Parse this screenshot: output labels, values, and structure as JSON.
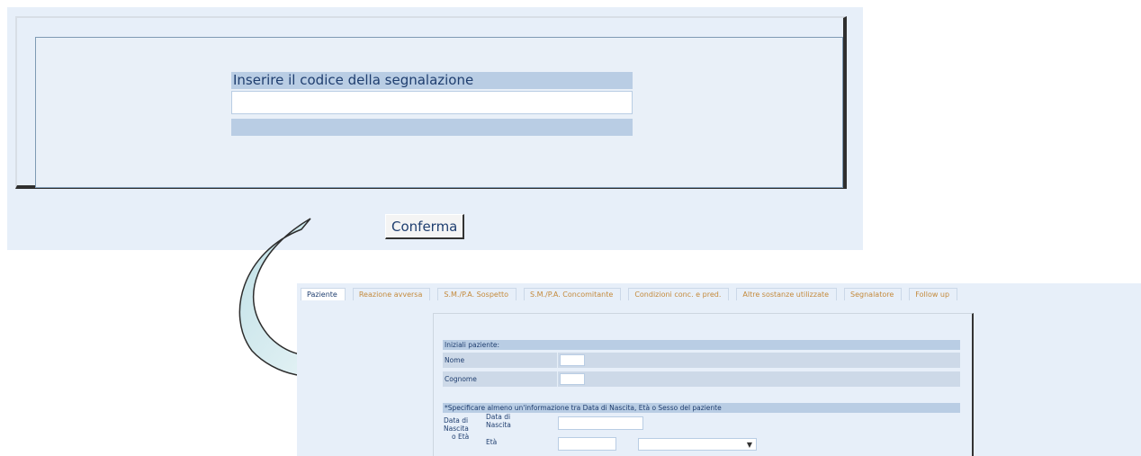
{
  "code_form": {
    "header": "Inserire il codice della segnalazione",
    "input_value": "",
    "confirm_label": "Conferma"
  },
  "patient_form": {
    "tabs": [
      "Paziente",
      "Reazione avversa",
      "S.M./P.A. Sospetto",
      "S.M./P.A. Concomitante",
      "Condizioni conc. e pred.",
      "Altre sostanze utilizzate",
      "Segnalatore",
      "Follow up"
    ],
    "initials_header": "Iniziali paziente:",
    "nome_label": "Nome",
    "cognome_label": "Cognome",
    "specify_header": "*Specificare almeno un'informazione tra Data di Nascita, Età o Sesso del paziente",
    "data_nascita_group_1": "Data di",
    "data_nascita_group_2": "Nascita",
    "data_nascita_group_3": "o Età",
    "data_nascita_sub_1": "Data di",
    "data_nascita_sub_2": "Nascita",
    "eta_label": "Età"
  },
  "colors": {
    "panel_bg": "#e7eff9",
    "header_bg": "#b9cde4",
    "text": "#1f3e6f",
    "tab_text": "#c48a3c"
  }
}
